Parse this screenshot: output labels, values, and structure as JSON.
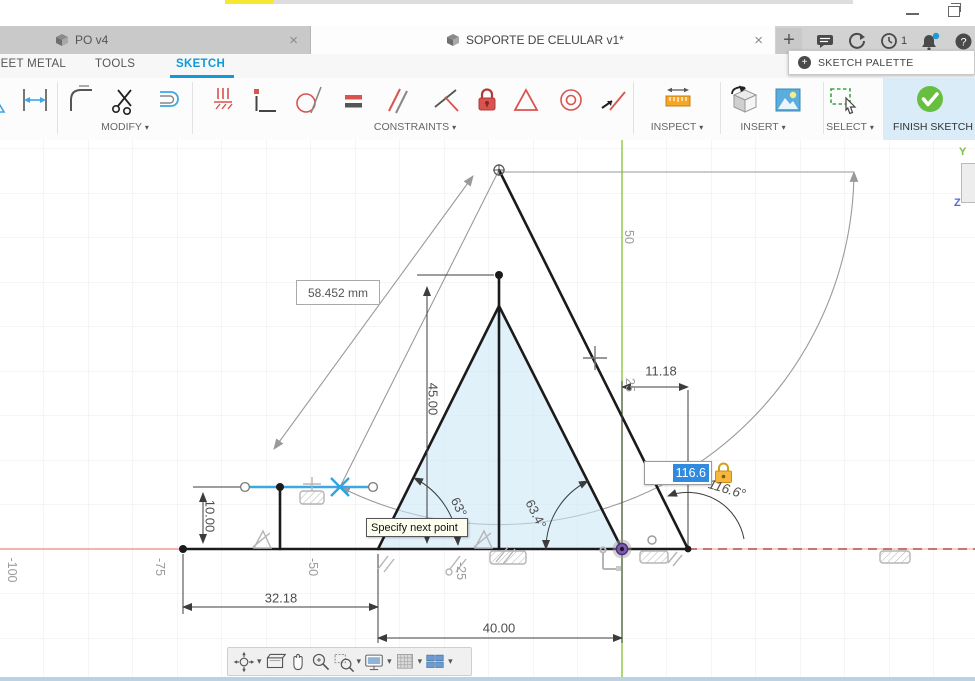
{
  "tabs": {
    "doc1": "PO v4",
    "doc2": "SOPORTE DE CELULAR v1*",
    "close_glyph": "×",
    "add_glyph": "+",
    "version_badge": "1",
    "help_glyph": "?"
  },
  "ribbon": {
    "env_tab": "SHEET METAL",
    "tools_tab": "TOOLS",
    "sketch_tab": "SKETCH",
    "modify_group": "MODIFY",
    "constraints_group": "CONSTRAINTS",
    "inspect_group": "INSPECT",
    "insert_group": "INSERT",
    "select_group": "SELECT",
    "finish_button": "FINISH SKETCH",
    "caret": "▾"
  },
  "palette": {
    "title": "SKETCH PALETTE",
    "plus_glyph": "+"
  },
  "canvas": {
    "tooltip": "Specify next point",
    "length_box": "58.452 mm",
    "angle_input": "116.6",
    "angle_label": "116.6°",
    "dims": {
      "d1118": "11.18",
      "d45": "45.00",
      "d63": "63°",
      "d634": "63.4°",
      "d10": "10.00",
      "d3218": "32.18",
      "d40": "40.00"
    },
    "grid_labels": {
      "y50": "50",
      "y25": "25",
      "xm25": "-25",
      "xm50": "-50",
      "xm75": "-75",
      "xm100": "-100"
    },
    "viewcube": {
      "y": "Y",
      "z": "Z"
    }
  },
  "colors": {
    "accent_blue": "#0f9bd7",
    "selection_blue": "#2f8ae0",
    "sketch_blue_line": "#3aa7e8",
    "axis_green": "#8dc63f",
    "axis_red": "#ef9a9a",
    "constraint_red": "#d9534f",
    "finish_green": "#67bf40",
    "finish_bg": "#d9ecf8",
    "lock_yellow": "#f6b73c"
  }
}
